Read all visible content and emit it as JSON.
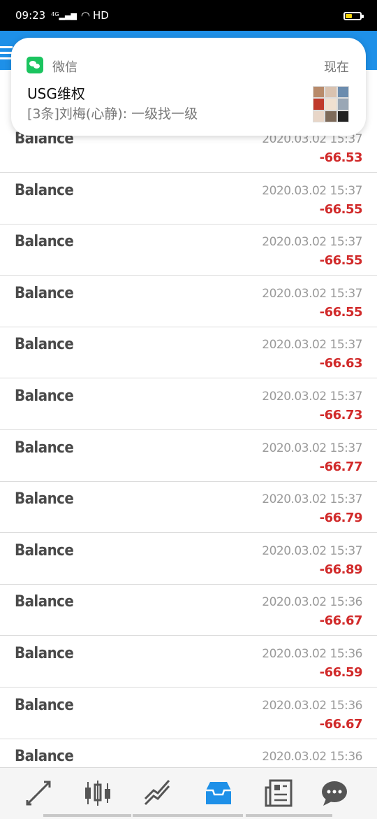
{
  "status_bar": {
    "time": "09:23",
    "network": "4G",
    "hd": "HD",
    "battery_color": "#f3d20b"
  },
  "notification": {
    "app_name": "微信",
    "time": "现在",
    "title": "USG维权",
    "body": "[3条]刘梅(心静): 一级找一级",
    "app_icon": "wechat-icon",
    "accent": "#1bc45f"
  },
  "header": {
    "color": "#1e90e8",
    "menu_icon": "hamburger-icon"
  },
  "deals": [
    {
      "type": "Balance",
      "date": "2020.03.02 15:37",
      "amount": "-66.53"
    },
    {
      "type": "Balance",
      "date": "2020.03.02 15:37",
      "amount": "-66.55"
    },
    {
      "type": "Balance",
      "date": "2020.03.02 15:37",
      "amount": "-66.55"
    },
    {
      "type": "Balance",
      "date": "2020.03.02 15:37",
      "amount": "-66.55"
    },
    {
      "type": "Balance",
      "date": "2020.03.02 15:37",
      "amount": "-66.63"
    },
    {
      "type": "Balance",
      "date": "2020.03.02 15:37",
      "amount": "-66.73"
    },
    {
      "type": "Balance",
      "date": "2020.03.02 15:37",
      "amount": "-66.77"
    },
    {
      "type": "Balance",
      "date": "2020.03.02 15:37",
      "amount": "-66.79"
    },
    {
      "type": "Balance",
      "date": "2020.03.02 15:37",
      "amount": "-66.89"
    },
    {
      "type": "Balance",
      "date": "2020.03.02 15:36",
      "amount": "-66.67"
    },
    {
      "type": "Balance",
      "date": "2020.03.02 15:36",
      "amount": "-66.59"
    },
    {
      "type": "Balance",
      "date": "2020.03.02 15:36",
      "amount": "-66.67"
    },
    {
      "type": "Balance",
      "date": "2020.03.02 15:36",
      "amount": ""
    }
  ],
  "colors": {
    "negative": "#d12a2a",
    "active_tab": "#1e90e8",
    "inactive_tab": "#555555"
  },
  "bottom_nav": [
    {
      "icon": "quotes-arrows-icon",
      "active": false
    },
    {
      "icon": "candlestick-chart-icon",
      "active": false
    },
    {
      "icon": "trade-lines-icon",
      "active": false
    },
    {
      "icon": "history-inbox-icon",
      "active": true
    },
    {
      "icon": "news-icon",
      "active": false
    },
    {
      "icon": "chat-icon",
      "active": false
    }
  ]
}
